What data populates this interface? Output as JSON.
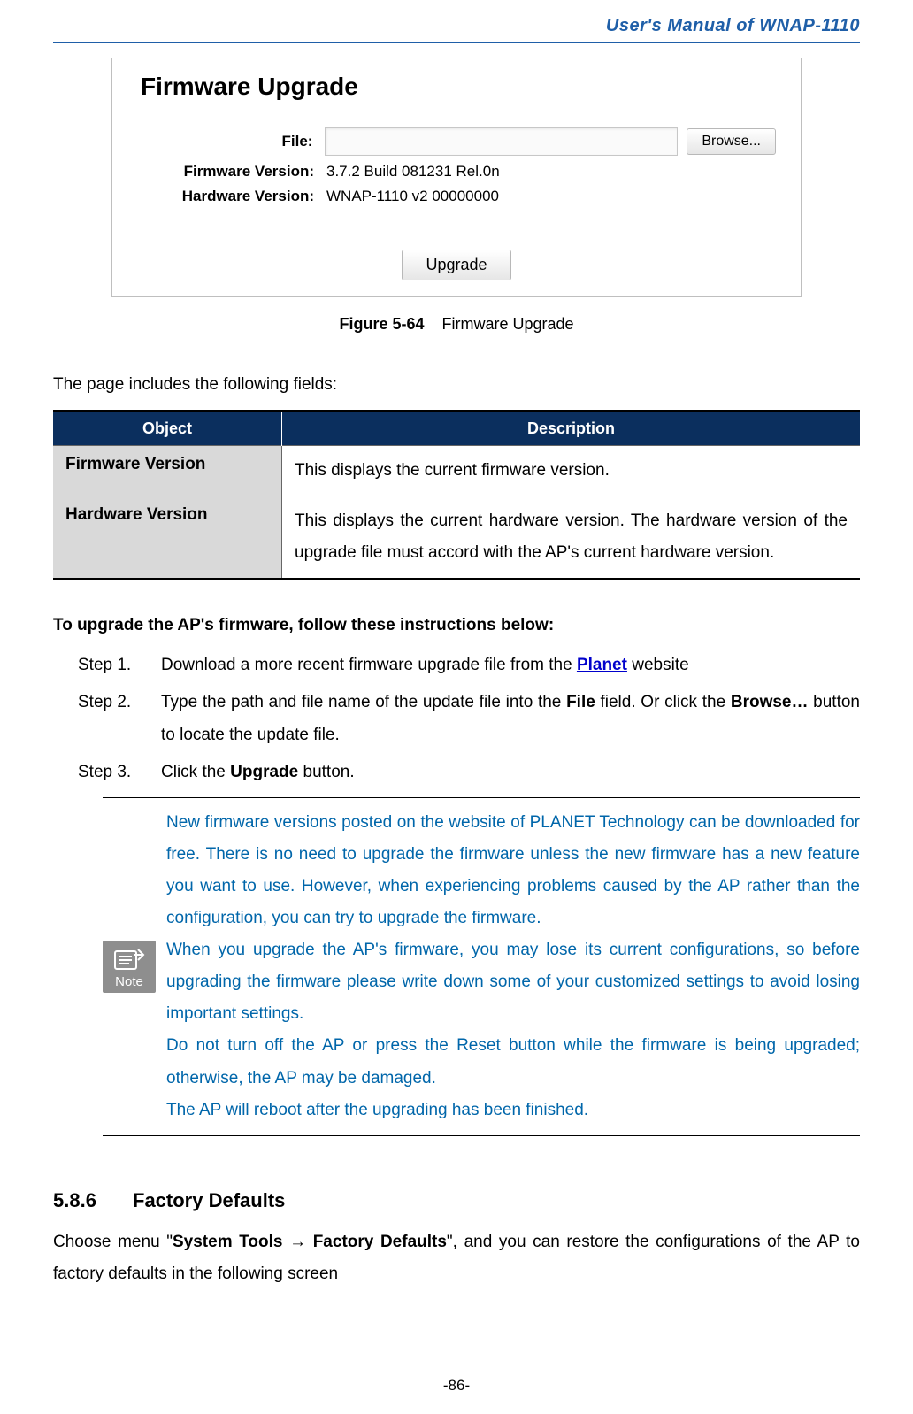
{
  "header": "User's  Manual  of  WNAP-1110",
  "screenshot": {
    "title": "Firmware Upgrade",
    "file_label": "File:",
    "browse_btn": "Browse...",
    "fw_label": "Firmware Version:",
    "fw_value": "3.7.2 Build 081231 Rel.0n",
    "hw_label": "Hardware Version:",
    "hw_value": "WNAP-1110 v2 00000000",
    "upgrade_btn": "Upgrade"
  },
  "caption_num": "Figure 5-64",
  "caption_text": "Firmware Upgrade",
  "fields_intro": "The page includes the following fields:",
  "table": {
    "head_obj": "Object",
    "head_desc": "Description",
    "rows": [
      {
        "obj": "Firmware Version",
        "desc": "This displays the current firmware version."
      },
      {
        "obj": "Hardware Version",
        "desc": "This  displays  the  current  hardware  version.  The  hardware  version  of  the upgrade file must accord with the AP's current hardware version."
      }
    ]
  },
  "steps_heading": "To upgrade the AP's firmware, follow these instructions below:",
  "steps": {
    "s1_label": "Step 1.",
    "s1_a": "Download a more recent firmware upgrade file from the ",
    "s1_link": "Planet",
    "s1_b": " website",
    "s2_label": "Step 2.",
    "s2_a": "Type the path and file name of the update file into the ",
    "s2_bold1": "File",
    "s2_b": " field. Or click the ",
    "s2_bold2": "Browse…",
    "s2_c": " button to locate the update file.",
    "s3_label": "Step 3.",
    "s3_a": "Click the ",
    "s3_bold": "Upgrade",
    "s3_b": " button."
  },
  "note": {
    "label": "Note",
    "p1": "New firmware versions posted on the website of PLANET Technology can be downloaded for free. There is no need to upgrade the firmware unless the new firmware has a new feature you want to use. However, when experiencing problems caused by the AP rather than the configuration, you can try to upgrade the firmware.",
    "p2": "When  you  upgrade  the  AP's  firmware,  you  may  lose  its  current  configurations,  so  before upgrading the firmware please write down some of your customized settings to avoid losing important settings.",
    "p3": "Do  not  turn  off  the  AP  or  press  the  Reset  button  while  the  firmware  is  being  upgraded; otherwise, the AP may be damaged.",
    "p4": "The AP will reboot after the upgrading has been finished."
  },
  "section": {
    "num": "5.8.6",
    "title": "Factory Defaults",
    "pre": "Choose menu \"",
    "bold": "System Tools → Factory Defaults",
    "post": "\", and you can restore the configurations of the AP to factory defaults in the following screen"
  },
  "footer": "-86-"
}
